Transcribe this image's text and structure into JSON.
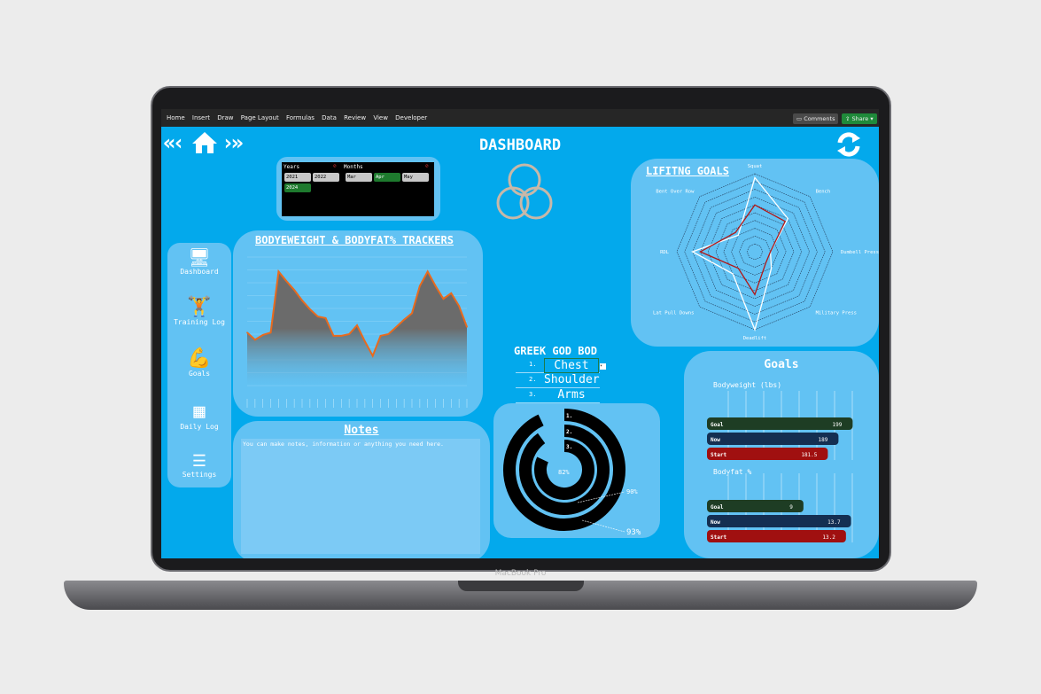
{
  "device_label": "MacBook Pro",
  "ribbon": {
    "tabs": [
      "Home",
      "Insert",
      "Draw",
      "Page Layout",
      "Formulas",
      "Data",
      "Review",
      "View",
      "Developer"
    ],
    "comments": "Comments",
    "share": "Share"
  },
  "header": {
    "title": "DASHBOARD"
  },
  "slicers": {
    "years_label": "Years",
    "years": [
      "2021",
      "2022",
      "2024"
    ],
    "years_selected": "2024",
    "months_label": "Months",
    "months": [
      "Mar",
      "Apr",
      "May"
    ],
    "months_selected": "Apr"
  },
  "sidebar": {
    "items": [
      {
        "label": "Dashboard",
        "icon": "monitor-user-icon"
      },
      {
        "label": "Training Log",
        "icon": "weightlifter-icon"
      },
      {
        "label": "Goals",
        "icon": "flexed-arm-icon"
      },
      {
        "label": "Daily Log",
        "icon": "calendar-icon"
      },
      {
        "label": "Settings",
        "icon": "sliders-icon"
      }
    ]
  },
  "colors": {
    "background": "#03a9ec",
    "panel": "#62c2f3",
    "line": "#e86a1e",
    "goal": "#1e3d24",
    "now": "#142f52",
    "start": "#a01010"
  },
  "chart_data": [
    {
      "type": "area",
      "title": "BODYEWEIGHT & BODYFAT% TRACKERS",
      "ylim": [
        170,
        186
      ],
      "grid": true,
      "values": [
        176.6,
        175.7,
        176.3,
        176.6,
        184.2,
        183.0,
        181.9,
        180.6,
        179.5,
        178.6,
        178.4,
        176.2,
        176.2,
        176.4,
        177.5,
        175.5,
        173.7,
        176.2,
        176.4,
        177.3,
        178.2,
        179.0,
        182.4,
        184.2,
        182.4,
        180.8,
        181.5,
        179.9,
        177.3
      ]
    },
    {
      "type": "radar",
      "title": "LIFITNG GOALS",
      "axes": [
        "Squat",
        "Bench",
        "Dumbell Press",
        "Military Press",
        "Deadlift",
        "Lat Pull Downs",
        "RDL",
        "Bent Over Row"
      ],
      "rmax": 10,
      "series": [
        {
          "color": "#ffffff",
          "values": [
            9.5,
            6,
            2,
            3,
            10,
            4,
            8,
            3
          ]
        },
        {
          "color": "#b01818",
          "values": [
            6,
            5.5,
            2,
            2,
            5.5,
            3,
            7,
            3.5
          ]
        }
      ]
    },
    {
      "type": "bar",
      "title": "Goals",
      "groups": [
        {
          "label": "Bodyweight (lbs)",
          "categories": [
            "Goal",
            "Now",
            "Start"
          ],
          "values": [
            199,
            189,
            181.5
          ],
          "xlim": [
            100,
            200
          ]
        },
        {
          "label": "Bodyfat %",
          "categories": [
            "Goal",
            "Now",
            "Start"
          ],
          "values": [
            9,
            13.7,
            13.2
          ],
          "xlim": [
            0,
            14
          ]
        }
      ]
    },
    {
      "type": "pie",
      "title": "GREEK GOD BOD",
      "rings": [
        {
          "label": "1.",
          "value": 93,
          "display": "93%"
        },
        {
          "label": "2.",
          "value": 90,
          "display": "90%"
        },
        {
          "label": "3.",
          "value": 82,
          "display": "82%"
        }
      ]
    }
  ],
  "greek": {
    "title": "GREEK GOD BOD",
    "rows": [
      {
        "n": "1.",
        "v": "Chest"
      },
      {
        "n": "2.",
        "v": "Shoulder"
      },
      {
        "n": "3.",
        "v": "Arms"
      }
    ]
  },
  "notes": {
    "title": "Notes",
    "text": "You can make notes, information or anything you need here."
  }
}
